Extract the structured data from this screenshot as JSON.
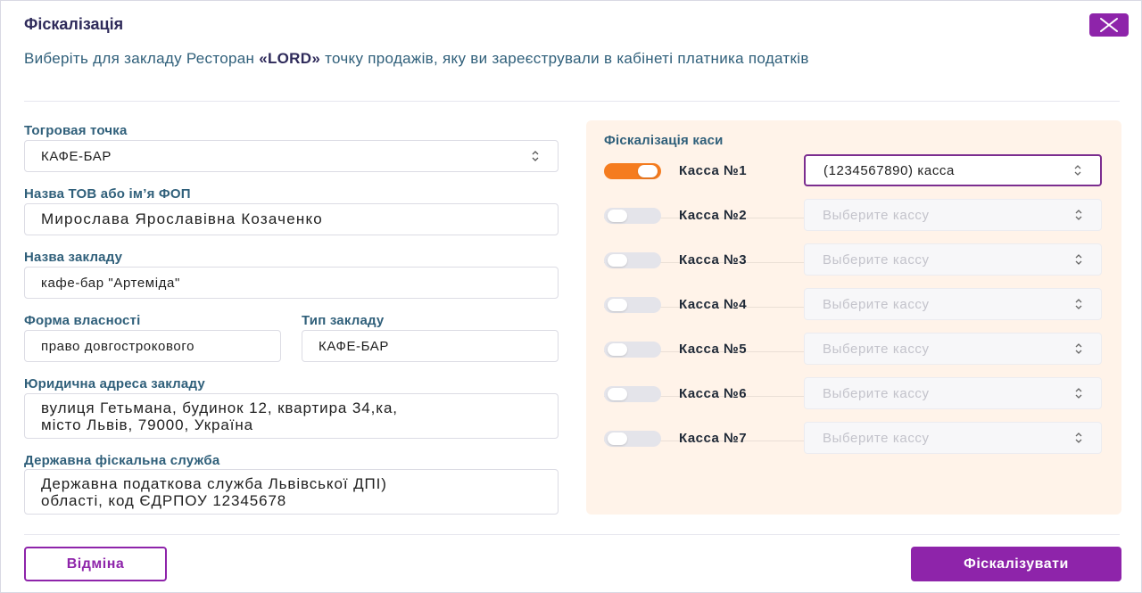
{
  "modal": {
    "title": "Фіскалізація",
    "subtitle_before": "Виберіть для закладу Ресторан ",
    "subtitle_bold": "«LORD»",
    "subtitle_after": " точку продажів, яку ви зареєстрували в кабінеті платника податків"
  },
  "form": {
    "trade_point": {
      "label": "Тогровая точка",
      "value": "КАФЕ-БАР"
    },
    "owner_name": {
      "label": "Назва ТОВ або ім’я ФОП",
      "value": "Мирослава Ярославівна Козаченко"
    },
    "venue_name": {
      "label": "Назва закладу",
      "value": "кафе-бар \"Артеміда\""
    },
    "ownership": {
      "label": "Форма власності",
      "value": "право довгострокового"
    },
    "venue_type": {
      "label": "Тип закладу",
      "value": "КАФЕ-БАР"
    },
    "legal_address": {
      "label": "Юридична адреса закладу",
      "value": "вулиця Гетьмана, будинок 12, квартира 34,ка,\nмісто Львів, 79000, Україна"
    },
    "fiscal_service": {
      "label": "Державна фіскальна служба",
      "value": "Державна податкова служба Львівської ДПІ)\nобласті, код ЄДРПОУ 12345678"
    }
  },
  "fiscal": {
    "title": "Фіскалізація каси",
    "registers": [
      {
        "label": "Касса №1",
        "enabled": true,
        "value": "(1234567890) касса"
      },
      {
        "label": "Касса №2",
        "enabled": false,
        "placeholder": "Выберите кассу"
      },
      {
        "label": "Касса №3",
        "enabled": false,
        "placeholder": "Выберите кассу"
      },
      {
        "label": "Касса №4",
        "enabled": false,
        "placeholder": "Выберите кассу"
      },
      {
        "label": "Касса №5",
        "enabled": false,
        "placeholder": "Выберите кассу"
      },
      {
        "label": "Касса №6",
        "enabled": false,
        "placeholder": "Выберите кассу"
      },
      {
        "label": "Касса №7",
        "enabled": false,
        "placeholder": "Выберите кассу"
      }
    ]
  },
  "footer": {
    "cancel_label": "Відміна",
    "submit_label": "Фіскалізувати"
  },
  "colors": {
    "accent": "#8e24aa",
    "toggle_on": "#f57c1f",
    "panel_bg": "#fff3e9",
    "label_text": "#2f5f7a"
  },
  "icons": {
    "close": "close-icon",
    "select": "chevron-up-down-icon"
  }
}
